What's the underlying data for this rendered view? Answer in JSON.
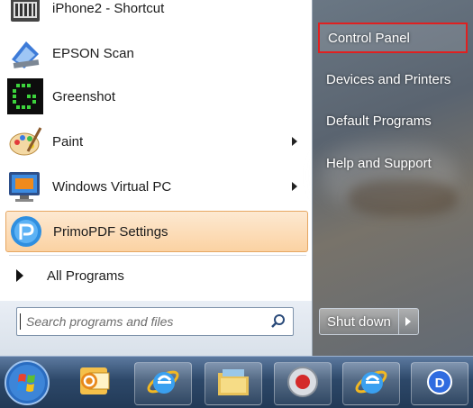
{
  "programs": [
    {
      "label": "iPhone2 - Shortcut",
      "icon": "iphone-shortcut-icon",
      "has_submenu": false
    },
    {
      "label": "EPSON Scan",
      "icon": "scanner-icon",
      "has_submenu": false
    },
    {
      "label": "Greenshot",
      "icon": "greenshot-icon",
      "has_submenu": false
    },
    {
      "label": "Paint",
      "icon": "paint-palette-icon",
      "has_submenu": true
    },
    {
      "label": "Windows Virtual PC",
      "icon": "virtual-pc-icon",
      "has_submenu": true
    },
    {
      "label": "PrimoPDF Settings",
      "icon": "primopdf-icon",
      "has_submenu": false,
      "highlighted": true
    }
  ],
  "all_programs_label": "All Programs",
  "search": {
    "placeholder": "Search programs and files"
  },
  "right_items": [
    {
      "label": "Control Panel",
      "selected": true
    },
    {
      "label": "Devices and Printers"
    },
    {
      "label": "Default Programs"
    },
    {
      "label": "Help and Support"
    }
  ],
  "shutdown_label": "Shut down",
  "taskbar": [
    "start-orb",
    "outlook-icon",
    "internet-explorer-icon",
    "file-explorer-icon",
    "media-record-icon",
    "internet-explorer-icon",
    "d-app-icon"
  ],
  "colors": {
    "highlight_border": "#e02020",
    "hover_gradient_end": "#fbd2a2"
  }
}
